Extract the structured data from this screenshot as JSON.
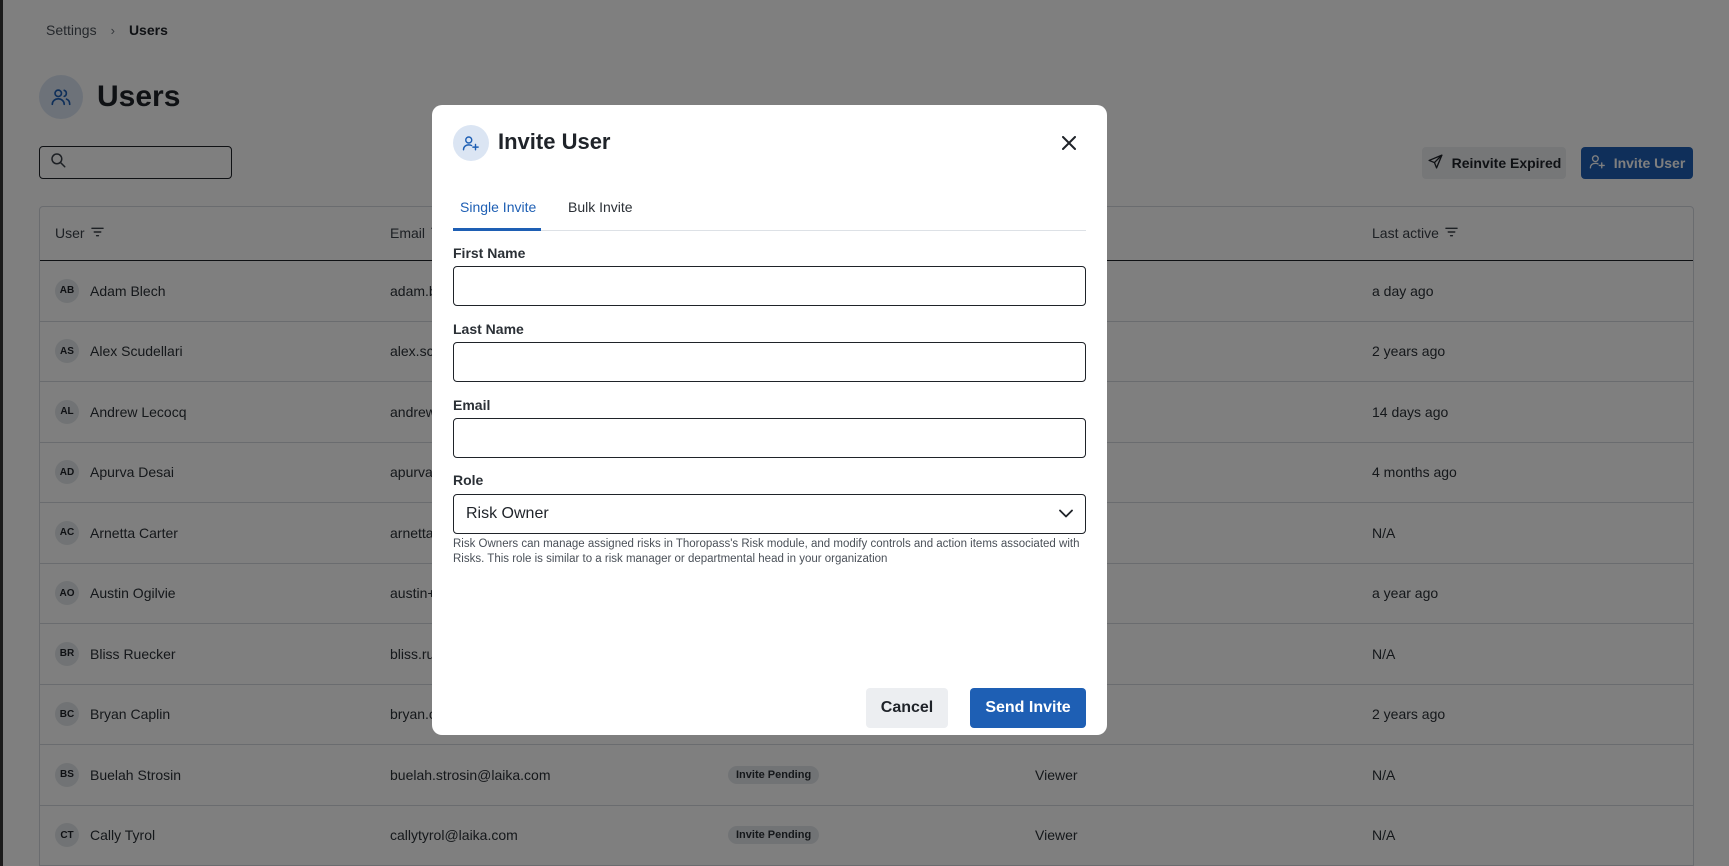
{
  "breadcrumb": {
    "items": [
      "Settings",
      "Users"
    ],
    "separator": "›"
  },
  "page": {
    "title": "Users",
    "title_icon": "users-icon"
  },
  "search": {
    "placeholder": ""
  },
  "toolbar": {
    "reinvite_label": "Reinvite Expired",
    "invite_label": "Invite User"
  },
  "table": {
    "headers": {
      "user": "User",
      "email": "Email",
      "last_active": "Last active"
    },
    "rows": [
      {
        "initials": "AB",
        "name": "Adam Blech",
        "email": "adam.b",
        "status": "",
        "role": "",
        "last_active": "a day ago"
      },
      {
        "initials": "AS",
        "name": "Alex Scudellari",
        "email": "alex.sc",
        "status": "",
        "role": "",
        "last_active": "2 years ago"
      },
      {
        "initials": "AL",
        "name": "Andrew Lecocq",
        "email": "andrew",
        "status": "",
        "role": "",
        "last_active": "14 days ago"
      },
      {
        "initials": "AD",
        "name": "Apurva Desai",
        "email": "apurva",
        "status": "",
        "role": "",
        "last_active": "4 months ago"
      },
      {
        "initials": "AC",
        "name": "Arnetta Carter",
        "email": "arnetta",
        "status": "",
        "role": "",
        "last_active": "N/A"
      },
      {
        "initials": "AO",
        "name": "Austin Ogilvie",
        "email": "austin+",
        "status": "",
        "role": "",
        "last_active": "a year ago"
      },
      {
        "initials": "BR",
        "name": "Bliss Ruecker",
        "email": "bliss.ru",
        "status": "",
        "role": "",
        "last_active": "N/A"
      },
      {
        "initials": "BC",
        "name": "Bryan Caplin",
        "email": "bryan.c",
        "status": "",
        "role": "",
        "last_active": "2 years ago"
      },
      {
        "initials": "BS",
        "name": "Buelah Strosin",
        "email": "buelah.strosin@laika.com",
        "status": "Invite Pending",
        "role": "Viewer",
        "last_active": "N/A"
      },
      {
        "initials": "CT",
        "name": "Cally Tyrol",
        "email": "callytyrol@laika.com",
        "status": "Invite Pending",
        "role": "Viewer",
        "last_active": "N/A"
      }
    ]
  },
  "modal": {
    "title": "Invite User",
    "icon": "user-plus-icon",
    "tabs": [
      {
        "label": "Single Invite",
        "active": true
      },
      {
        "label": "Bulk Invite",
        "active": false
      }
    ],
    "fields": {
      "first_name": {
        "label": "First Name",
        "value": ""
      },
      "last_name": {
        "label": "Last Name",
        "value": ""
      },
      "email": {
        "label": "Email",
        "value": ""
      },
      "role": {
        "label": "Role",
        "value": "Risk Owner"
      }
    },
    "role_description": "Risk Owners can manage assigned risks in Thoropass's Risk module, and modify controls and action items associated with Risks. This role is similar to a risk manager or departmental head in your organization",
    "cancel_label": "Cancel",
    "send_label": "Send Invite"
  },
  "colors": {
    "primary": "#1e5fb4",
    "overlay": "rgba(0,0,0,0.5)",
    "icon_bg": "#dbe5f3"
  }
}
